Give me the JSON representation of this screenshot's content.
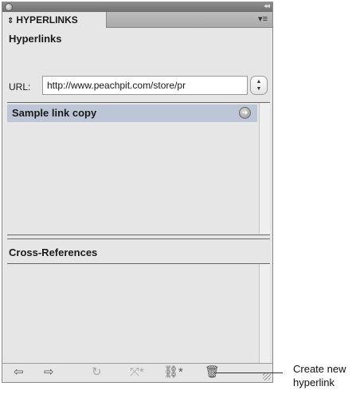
{
  "panel": {
    "collapse_glyph": "◂◂",
    "tab_arrows": "⇕",
    "tab_label": "HYPERLINKS",
    "menu_glyph": "▾≡",
    "section_title": "Hyperlinks",
    "url_label": "URL:",
    "url_value": "http://www.peachpit.com/store/pr",
    "stepper_up": "▲",
    "stepper_down": "▼",
    "hyperlinks": [
      {
        "label": "Sample link copy",
        "selected": true
      }
    ],
    "xref_title": "Cross-References"
  },
  "toolbar": {
    "icons": [
      {
        "name": "go-to-source-icon",
        "glyph": "⇦"
      },
      {
        "name": "go-to-destination-icon",
        "glyph": "⇨"
      },
      {
        "name": "update-icon",
        "glyph": "↻"
      },
      {
        "name": "create-cross-reference-icon",
        "glyph": "⤧*"
      },
      {
        "name": "create-hyperlink-icon",
        "glyph": "⛓*"
      },
      {
        "name": "delete-icon",
        "glyph": "🗑"
      }
    ]
  },
  "callout": {
    "line1": "Create new",
    "line2": "hyperlink"
  },
  "colors": {
    "panel_bg": "#e6e6e6",
    "selected_row": "#bdc6d6"
  }
}
